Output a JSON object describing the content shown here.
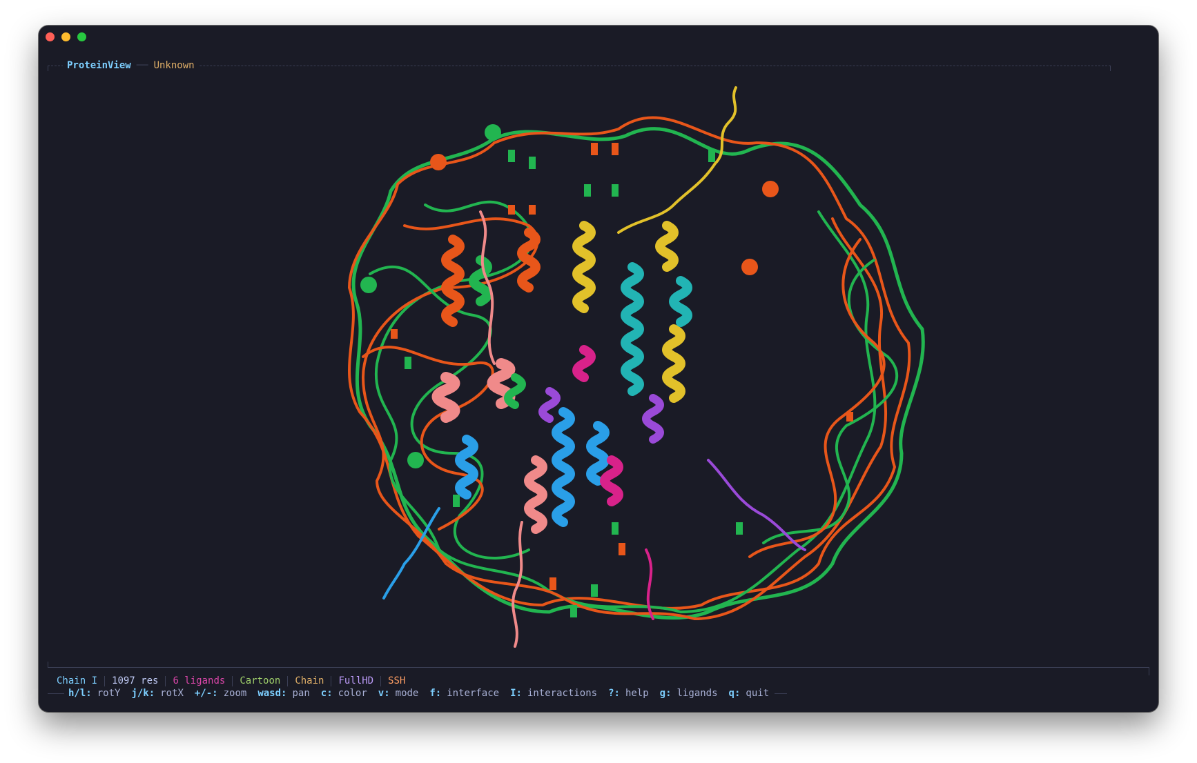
{
  "header": {
    "app_title": "ProteinView",
    "subtitle": "Unknown"
  },
  "status": {
    "chain": "Chain I",
    "residues": "1097 res",
    "ligands": "6 ligands",
    "render_mode": "Cartoon",
    "color_mode": "Chain",
    "resolution": "FullHD",
    "connection": "SSH"
  },
  "help": {
    "items": [
      {
        "key": "h/l:",
        "desc": "rotY"
      },
      {
        "key": "j/k:",
        "desc": "rotX"
      },
      {
        "key": "+/-:",
        "desc": "zoom"
      },
      {
        "key": "wasd:",
        "desc": "pan"
      },
      {
        "key": "c:",
        "desc": "color"
      },
      {
        "key": "v:",
        "desc": "mode"
      },
      {
        "key": "f:",
        "desc": "interface"
      },
      {
        "key": "I:",
        "desc": "interactions"
      },
      {
        "key": "?:",
        "desc": "help"
      },
      {
        "key": "g:",
        "desc": "ligands"
      },
      {
        "key": "q:",
        "desc": "quit"
      }
    ]
  },
  "colors": {
    "background": "#1a1b26",
    "dna_green": "#22b550",
    "dna_orange": "#e8561a",
    "helix_yellow": "#e2c12a",
    "helix_cyan": "#22b4b4",
    "helix_blue": "#2a9fe8",
    "helix_salmon": "#f08a8a",
    "helix_magenta": "#d8228a",
    "helix_purple": "#9a4ad8"
  },
  "viewer": {
    "model": "nucleosome-cartoon"
  }
}
